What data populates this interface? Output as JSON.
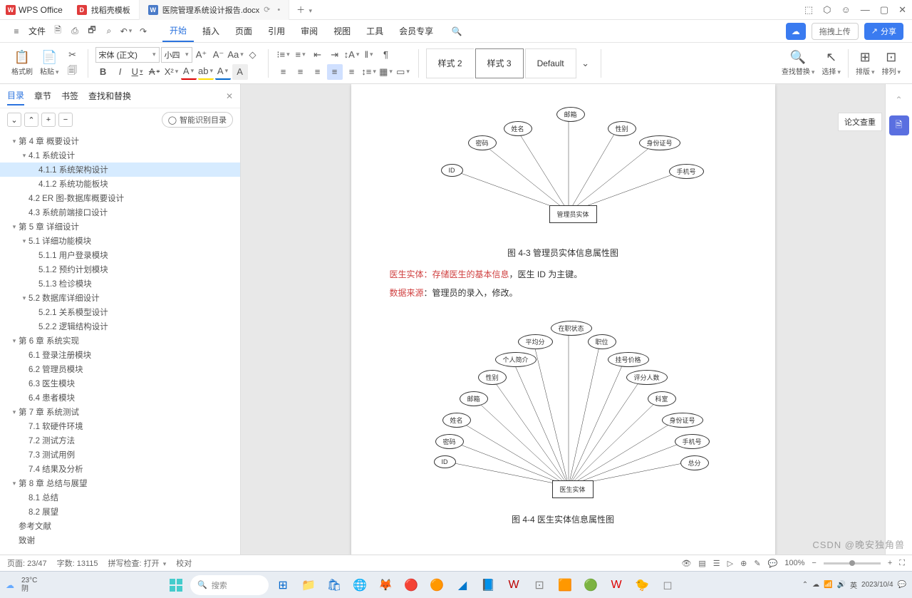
{
  "app": {
    "name": "WPS Office"
  },
  "tabs": [
    {
      "label": "找稻壳模板",
      "icon": "D",
      "iconBg": "#e03c3c"
    },
    {
      "label": "医院管理系统设计报告.docx",
      "icon": "W",
      "iconBg": "#4a7bc8",
      "active": true
    }
  ],
  "menu": {
    "file": "文件",
    "items": [
      "开始",
      "插入",
      "页面",
      "引用",
      "审阅",
      "视图",
      "工具",
      "会员专享"
    ],
    "active": "开始",
    "upload": "拖拽上传",
    "share": "分享"
  },
  "ribbon": {
    "formatPainter": "格式刷",
    "paste": "粘贴",
    "font": "宋体 (正文)",
    "size": "小四",
    "styles": {
      "s2": "样式 2",
      "s3": "样式 3",
      "def": "Default"
    },
    "groups": {
      "findReplace": "查找替换",
      "select": "选择",
      "layout": "排版",
      "arrange": "排列"
    }
  },
  "nav": {
    "tabs": [
      "目录",
      "章节",
      "书签",
      "查找和替换"
    ],
    "active": "目录",
    "smartBtn": "智能识别目录",
    "outline": [
      {
        "l": 0,
        "t": "第 4 章 概要设计",
        "a": true
      },
      {
        "l": 1,
        "t": "4.1 系统设计",
        "a": true
      },
      {
        "l": 2,
        "t": "4.1.1 系统架构设计",
        "sel": true
      },
      {
        "l": 2,
        "t": "4.1.2 系统功能板块"
      },
      {
        "l": 1,
        "t": "4.2 ER 图-数据库概要设计"
      },
      {
        "l": 1,
        "t": "4.3 系统前端接口设计"
      },
      {
        "l": 0,
        "t": "第 5 章 详细设计",
        "a": true
      },
      {
        "l": 1,
        "t": "5.1 详细功能模块",
        "a": true
      },
      {
        "l": 2,
        "t": "5.1.1 用户登录模块"
      },
      {
        "l": 2,
        "t": "5.1.2 预约计划模块"
      },
      {
        "l": 2,
        "t": "5.1.3 检诊模块"
      },
      {
        "l": 1,
        "t": "5.2 数据库详细设计",
        "a": true
      },
      {
        "l": 2,
        "t": "5.2.1 关系模型设计"
      },
      {
        "l": 2,
        "t": "5.2.2 逻辑结构设计"
      },
      {
        "l": 0,
        "t": "第 6 章 系统实现",
        "a": true
      },
      {
        "l": 1,
        "t": "6.1 登录注册模块"
      },
      {
        "l": 1,
        "t": "6.2 管理员模块"
      },
      {
        "l": 1,
        "t": "6.3 医生模块"
      },
      {
        "l": 1,
        "t": "6.4 患者模块"
      },
      {
        "l": 0,
        "t": "第 7 章 系统测试",
        "a": true
      },
      {
        "l": 1,
        "t": "7.1 软硬件环境"
      },
      {
        "l": 1,
        "t": "7.2 测试方法"
      },
      {
        "l": 1,
        "t": "7.3 测试用例"
      },
      {
        "l": 1,
        "t": "7.4 结果及分析"
      },
      {
        "l": 0,
        "t": "第 8 章 总结与展望",
        "a": true
      },
      {
        "l": 1,
        "t": "8.1 总结"
      },
      {
        "l": 1,
        "t": "8.2 展望"
      },
      {
        "l": 0,
        "t": "参考文献"
      },
      {
        "l": 0,
        "t": "致谢"
      }
    ]
  },
  "doc": {
    "diag1": {
      "center": "管理员实体",
      "attrs": [
        "ID",
        "密码",
        "姓名",
        "邮箱",
        "性别",
        "身份证号",
        "手机号"
      ],
      "caption": "图 4-3 管理员实体信息属性图"
    },
    "para1a": "医生实体：存储",
    "para1b": "医生的基本信息",
    "para1c": "，医生 ID 为主键。",
    "para2a": "数据来源",
    "para2b": "：管理员的录入，修改。",
    "diag2": {
      "center": "医生实体",
      "attrs": [
        "ID",
        "密码",
        "姓名",
        "邮箱",
        "性别",
        "个人简介",
        "平均分",
        "在职状态",
        "职位",
        "挂号价格",
        "评分人数",
        "科室",
        "身份证号",
        "手机号",
        "总分"
      ],
      "caption": "图 4-4 医生实体信息属性图"
    }
  },
  "rightPanel": {
    "label": "论文查重"
  },
  "status": {
    "page": "页面: 23/47",
    "words": "字数: 13115",
    "spell": "拼写检查: 打开",
    "proof": "校对",
    "zoom": "100%"
  },
  "taskbar": {
    "temp": "23°C",
    "weather": "阴",
    "search": "搜索",
    "time": "2023/10/4"
  },
  "watermark": "CSDN @晚安独角兽"
}
